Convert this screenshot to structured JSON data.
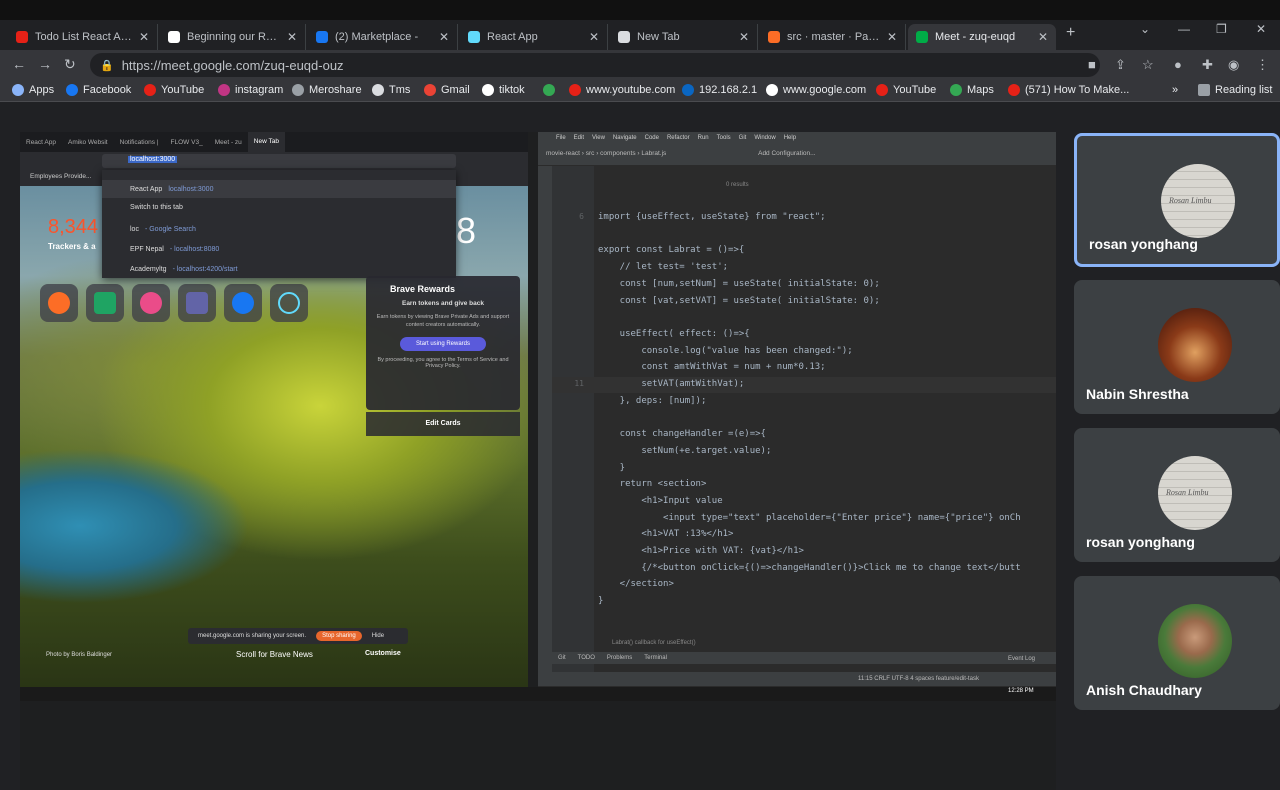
{
  "browser": {
    "tabs": [
      {
        "title": "Todo List React App |",
        "color": "#e62117"
      },
      {
        "title": "Beginning our React !",
        "color": "#ffffff"
      },
      {
        "title": "(2) Marketplace -",
        "color": "#1877f2"
      },
      {
        "title": "React App",
        "color": "#61dafb"
      },
      {
        "title": "New Tab",
        "color": "#dadce0"
      },
      {
        "title": "src · master · Pallabi L",
        "color": "#fc6d26"
      },
      {
        "title": "Meet - zuq-euqd",
        "color": "#00ac47"
      }
    ],
    "url": "https://meet.google.com/zuq-euqd-ouz",
    "bookmarks": [
      {
        "label": "Apps",
        "color": "#8ab4f8"
      },
      {
        "label": "Facebook",
        "color": "#1877f2"
      },
      {
        "label": "YouTube",
        "color": "#e62117"
      },
      {
        "label": "instagram",
        "color": "#c13584"
      },
      {
        "label": "Meroshare",
        "color": "#9aa0a6"
      },
      {
        "label": "Tms",
        "color": "#dadce0"
      },
      {
        "label": "Gmail",
        "color": "#ea4335"
      },
      {
        "label": "tiktok",
        "color": "#ffffff"
      },
      {
        "label": "",
        "color": "#34a853"
      },
      {
        "label": "www.youtube.com",
        "color": "#e62117"
      },
      {
        "label": "192.168.2.1",
        "color": "#0a66c2"
      },
      {
        "label": "www.google.com",
        "color": "#ffffff"
      },
      {
        "label": "YouTube",
        "color": "#e62117"
      },
      {
        "label": "Maps",
        "color": "#34a853"
      },
      {
        "label": "(571) How To Make...",
        "color": "#e62117"
      }
    ],
    "reading_list": "Reading list"
  },
  "shared_screen": {
    "brave": {
      "tabs": [
        "React App",
        "Amiko Websit",
        "Notifications |",
        "FLOW V3_",
        "Meet - zu",
        "New Tab"
      ],
      "omnibox_value": "localhost:3000",
      "bookmark": "Employees Provide...",
      "suggestions": [
        {
          "label": "React App",
          "hint": "localhost:3000"
        },
        {
          "label": "Switch to this tab",
          "hint": ""
        },
        {
          "label": "loc",
          "hint": "- Google Search"
        },
        {
          "label": "EPF Nepal",
          "hint": "- localhost:8080"
        },
        {
          "label": "Academyltg",
          "hint": "- localhost:4200/start"
        }
      ],
      "trackers_count": "8,344",
      "trackers_label": "Trackers & a",
      "clock": "8",
      "rewards": {
        "title": "Brave Rewards",
        "subtitle": "Earn tokens and give back",
        "body": "Earn tokens by viewing Brave Private Ads and support content creators automatically.",
        "button": "Start using Rewards",
        "note": "By proceeding, you agree to the Terms of Service and Privacy Policy."
      },
      "edit_cards": "Edit Cards",
      "sharing_text": "meet.google.com is sharing your screen.",
      "stop_sharing": "Stop sharing",
      "hide": "Hide",
      "photo_credit": "Photo by Boris Baldinger",
      "scroll_text": "Scroll for Brave News",
      "customise": "Customise",
      "taskbar_time": "12:28 PM"
    },
    "ide": {
      "menu": [
        "File",
        "Edit",
        "View",
        "Navigate",
        "Code",
        "Refactor",
        "Run",
        "Tools",
        "Git",
        "Window",
        "Help"
      ],
      "breadcrumb": "movie-react › src › components › Labrat.js",
      "config": "Add Configuration...",
      "results": "0 results",
      "code_lines": [
        {
          "n": "6",
          "text": "import {useEffect, useState} from \"react\";"
        },
        {
          "n": "",
          "text": ""
        },
        {
          "n": "",
          "text": "export const Labrat = ()=>{"
        },
        {
          "n": "",
          "text": "    // let test= 'test';"
        },
        {
          "n": "",
          "text": "    const [num,setNum] = useState( initialState: 0);"
        },
        {
          "n": "",
          "text": "    const [vat,setVAT] = useState( initialState: 0);"
        },
        {
          "n": "",
          "text": ""
        },
        {
          "n": "",
          "text": "    useEffect( effect: ()=>{"
        },
        {
          "n": "",
          "text": "        console.log(\"value has been changed:\");"
        },
        {
          "n": "",
          "text": "        const amtWithVat = num + num*0.13;"
        },
        {
          "n": "11",
          "text": "        setVAT(amtWithVat);"
        },
        {
          "n": "",
          "text": "    }, deps: [num]);"
        },
        {
          "n": "",
          "text": ""
        },
        {
          "n": "",
          "text": "    const changeHandler =(e)=>{"
        },
        {
          "n": "",
          "text": "        setNum(+e.target.value);"
        },
        {
          "n": "",
          "text": "    }"
        },
        {
          "n": "",
          "text": "    return <section>"
        },
        {
          "n": "",
          "text": "        <h1>Input value"
        },
        {
          "n": "",
          "text": "            <input type=\"text\" placeholder={\"Enter price\"} name={\"price\"} onCh"
        },
        {
          "n": "",
          "text": "        <h1>VAT :13%</h1>"
        },
        {
          "n": "",
          "text": "        <h1>Price with VAT: {vat}</h1>"
        },
        {
          "n": "",
          "text": "        {/*<button onClick={()=>changeHandler()}>Click me to change text</butt"
        },
        {
          "n": "",
          "text": "    </section>"
        },
        {
          "n": "",
          "text": "}"
        }
      ],
      "footer_crumb": "Labrat()    callback for useEffect()",
      "status_tabs": [
        "Git",
        "TODO",
        "Problems",
        "Terminal"
      ],
      "event_log": "Event Log",
      "status_right": "11:15   CRLF   UTF-8   4 spaces   feature/edit-task"
    }
  },
  "participants": [
    {
      "name": "rosan yonghang",
      "avatar": "paper",
      "active": true
    },
    {
      "name": "Nabin Shrestha",
      "avatar": "room",
      "active": false
    },
    {
      "name": "rosan yonghang",
      "avatar": "paper",
      "active": false
    },
    {
      "name": "Anish Chaudhary",
      "avatar": "person",
      "active": false
    }
  ],
  "avatar_paper_text": "Rosan Limbu",
  "colors": {
    "accent": "#8ab4f8",
    "chrome_bg": "#202124",
    "toolbar_bg": "#35363a"
  }
}
